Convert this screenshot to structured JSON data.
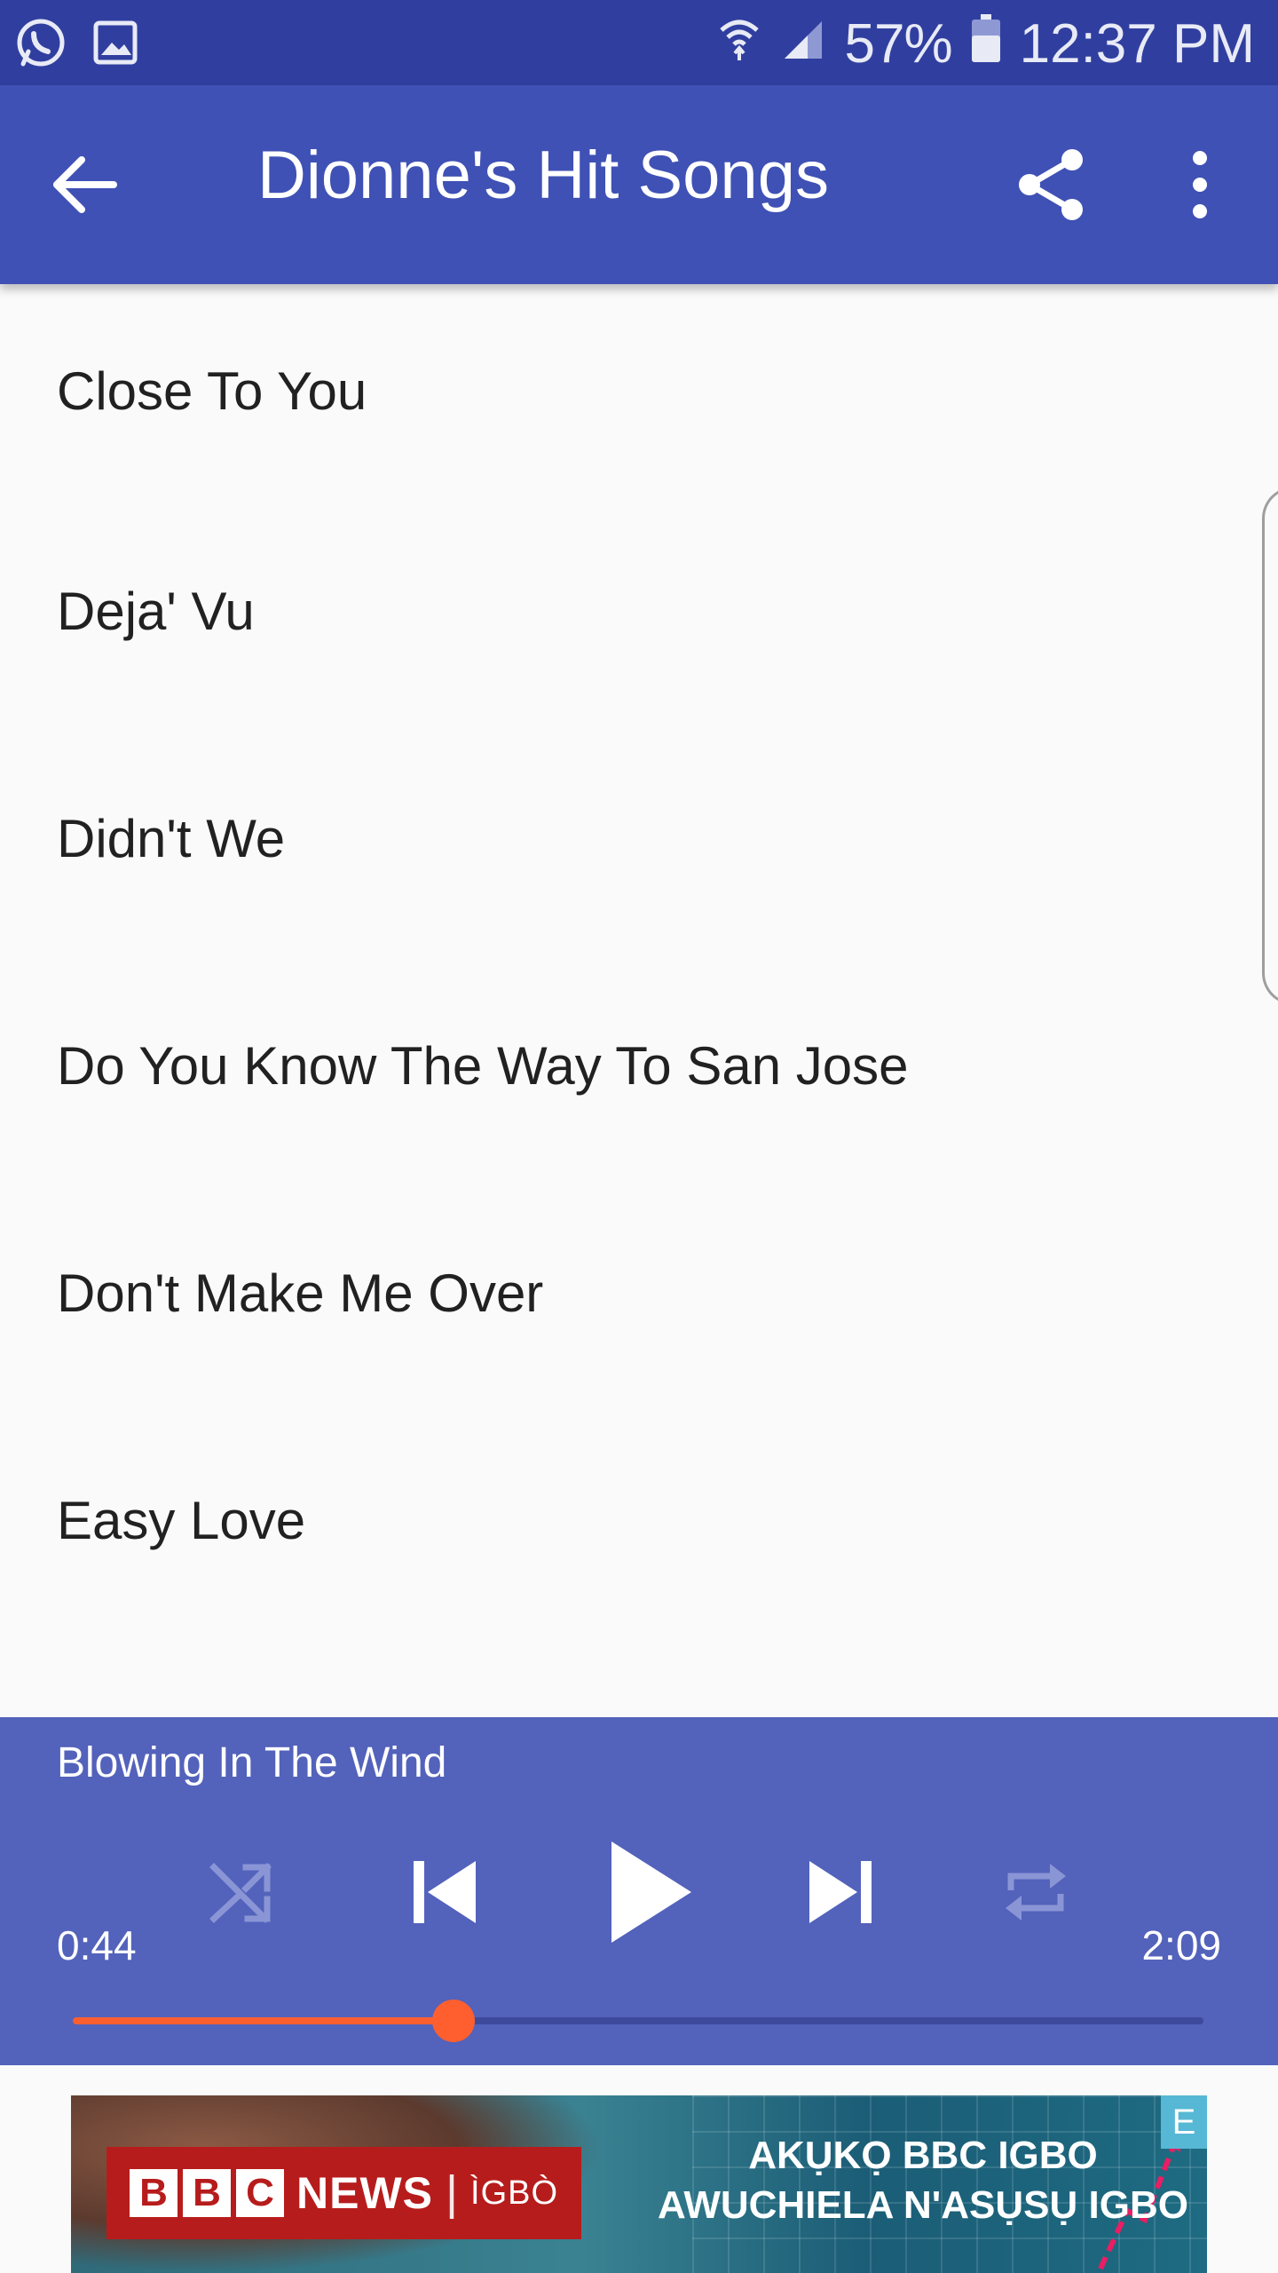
{
  "status_bar": {
    "battery": "57%",
    "time": "12:37 PM",
    "icons_left": [
      "whatsapp-icon",
      "gallery-icon"
    ],
    "icons_right": [
      "wifi-icon",
      "signal-icon",
      "battery-icon"
    ]
  },
  "app_bar": {
    "title": "Dionne's Hit Songs",
    "back_icon": "arrow-back-icon",
    "share_icon": "share-icon",
    "more_icon": "more-vert-icon"
  },
  "songs": [
    {
      "title": "Close To You"
    },
    {
      "title": "Deja' Vu"
    },
    {
      "title": "Didn't We"
    },
    {
      "title": "Do You Know The Way To San Jose"
    },
    {
      "title": "Don't Make Me Over"
    },
    {
      "title": "Easy Love"
    }
  ],
  "player": {
    "now_playing": "Blowing In The Wind",
    "elapsed": "0:44",
    "duration": "2:09",
    "progress": 0.337,
    "accent_color": "#ff5f2e",
    "background_color": "#5362bb",
    "controls": [
      "shuffle-icon",
      "skip-previous-icon",
      "play-icon",
      "skip-next-icon",
      "repeat-icon"
    ]
  },
  "ad": {
    "brand_letters": [
      "B",
      "B",
      "C"
    ],
    "brand_news": "NEWS",
    "brand_separator": "|",
    "brand_lang": "ÌGBÒ",
    "tagline_line1": "AKỤKỌ BBC IGBO",
    "tagline_line2": "AWUCHIELA N'ASỤSỤ IGBO",
    "badge": "E"
  },
  "colors": {
    "status_bar": "#303f9f",
    "app_bar": "#3f51b5",
    "list_background": "#fafafa",
    "list_text": "#212121"
  }
}
